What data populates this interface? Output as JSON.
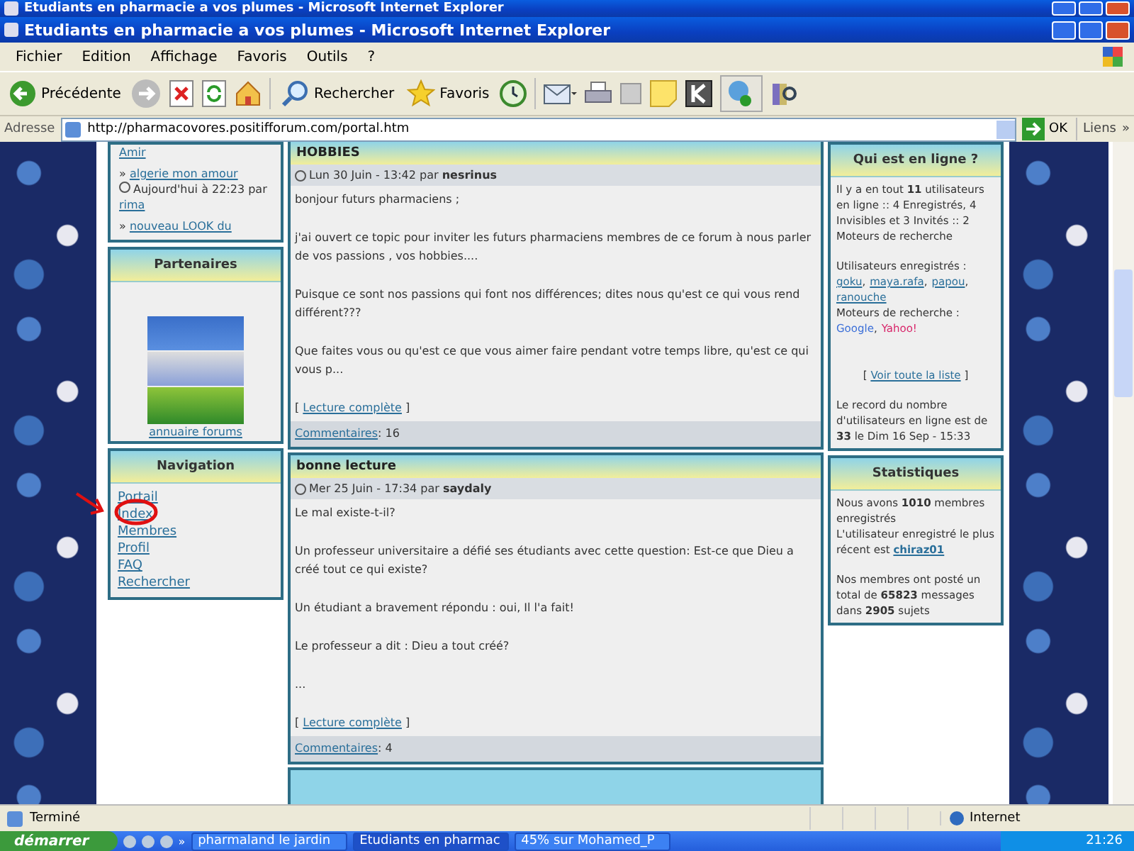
{
  "back_window": {
    "title": "Etudiants en pharmacie a vos plumes - Microsoft Internet Explorer"
  },
  "window": {
    "title": "Etudiants en pharmacie a vos plumes - Microsoft Internet Explorer"
  },
  "menu": [
    "Fichier",
    "Edition",
    "Affichage",
    "Favoris",
    "Outils",
    "?"
  ],
  "toolbar": {
    "back": "Précédente",
    "search": "Rechercher",
    "favorites": "Favoris"
  },
  "address": {
    "label": "Adresse",
    "url": "http://pharmacovores.positifforum.com/portal.htm",
    "go": "OK",
    "links": "Liens",
    "more": "»"
  },
  "left": {
    "recent": [
      {
        "kind": "tail",
        "link": "Amir"
      },
      {
        "kind": "topic",
        "bullet": "»",
        "link": "algerie mon amour",
        "meta": "Aujourd'hui à 22:23 par",
        "author": "rima"
      },
      {
        "kind": "topic",
        "bullet": "»",
        "link": "nouveau LOOK du"
      }
    ],
    "partners": {
      "title": "Partenaires",
      "link": "annuaire forums"
    },
    "nav": {
      "title": "Navigation",
      "items": [
        "Portail",
        "Index",
        "Membres",
        "Profil",
        "FAQ",
        "Rechercher"
      ]
    }
  },
  "posts": [
    {
      "title": "HOBBIES",
      "date": "Lun 30 Juin - 13:42 par",
      "author": "nesrinus",
      "paragraphs": [
        "bonjour futurs pharmaciens ;",
        "j'ai ouvert ce topic pour inviter les futurs pharmaciens membres de ce forum à nous parler de vos passions , vos hobbies....",
        "Puisque ce sont nos passions qui font nos différences; dites nous qu'est ce qui vous rend différent???",
        "Que faites vous ou qu'est ce que vous aimer faire pendant votre temps libre, qu'est ce qui vous p..."
      ],
      "read_open": "[",
      "read_more": "Lecture complète",
      "read_close": "]",
      "comments": "Commentaires",
      "count": ": 16"
    },
    {
      "title": "bonne lecture",
      "date": "Mer 25 Juin - 17:34 par",
      "author": "saydaly",
      "paragraphs": [
        "Le mal existe-t-il?",
        "Un professeur universitaire a défié ses étudiants avec cette question: Est-ce que Dieu a créé tout ce qui existe?",
        "Un étudiant a bravement répondu : oui, Il l'a fait!",
        "Le professeur a dit : Dieu a tout créé?",
        "..."
      ],
      "read_open": "[",
      "read_more": "Lecture complète",
      "read_close": "]",
      "comments": "Commentaires",
      "count": ": 4"
    }
  ],
  "online": {
    "title": "Qui est en ligne ?",
    "summary": "Il y a en tout **11** utilisateurs en ligne :: 4 Enregistrés, 4 Invisibles et 3 Invités :: 2 Moteurs de recherche",
    "users_label": "Utilisateurs enregistrés :",
    "users": [
      {
        "name": "goku",
        "sep": ","
      },
      {
        "name": "maya.rafa",
        "sep": ","
      },
      {
        "name": "papou",
        "sep": ","
      },
      {
        "name": "ranouche"
      }
    ],
    "bots_label": "Moteurs de recherche :",
    "bots": [
      {
        "name": "Google",
        "sep": ",",
        "color": "#3b6fd8"
      },
      {
        "name": "Yahoo!",
        "color": "#d8266a"
      }
    ],
    "list_open": "[",
    "list_link": "Voir toute la liste",
    "list_close": "]",
    "record": "Le record du nombre d'utilisateurs en ligne est de **33** le Dim 16 Sep - 15:33"
  },
  "stats": {
    "title": "Statistiques",
    "members": "Nous avons **1010** membres enregistrés",
    "newest": "L'utilisateur enregistré le plus récent est",
    "newest_user": "chiraz01",
    "posts": "Nos membres ont posté un total de **65823** messages dans **2905** sujets"
  },
  "status_bar": {
    "text": "Terminé",
    "zone": "Internet"
  },
  "taskbar": {
    "start": "démarrer",
    "more": "»",
    "tasks": [
      {
        "label": "pharmaland le jardin",
        "selected": false
      },
      {
        "label": "Etudiants en pharmac",
        "selected": true
      },
      {
        "label": "45% sur Mohamed_P",
        "selected": false
      }
    ],
    "clock": "21:26"
  }
}
